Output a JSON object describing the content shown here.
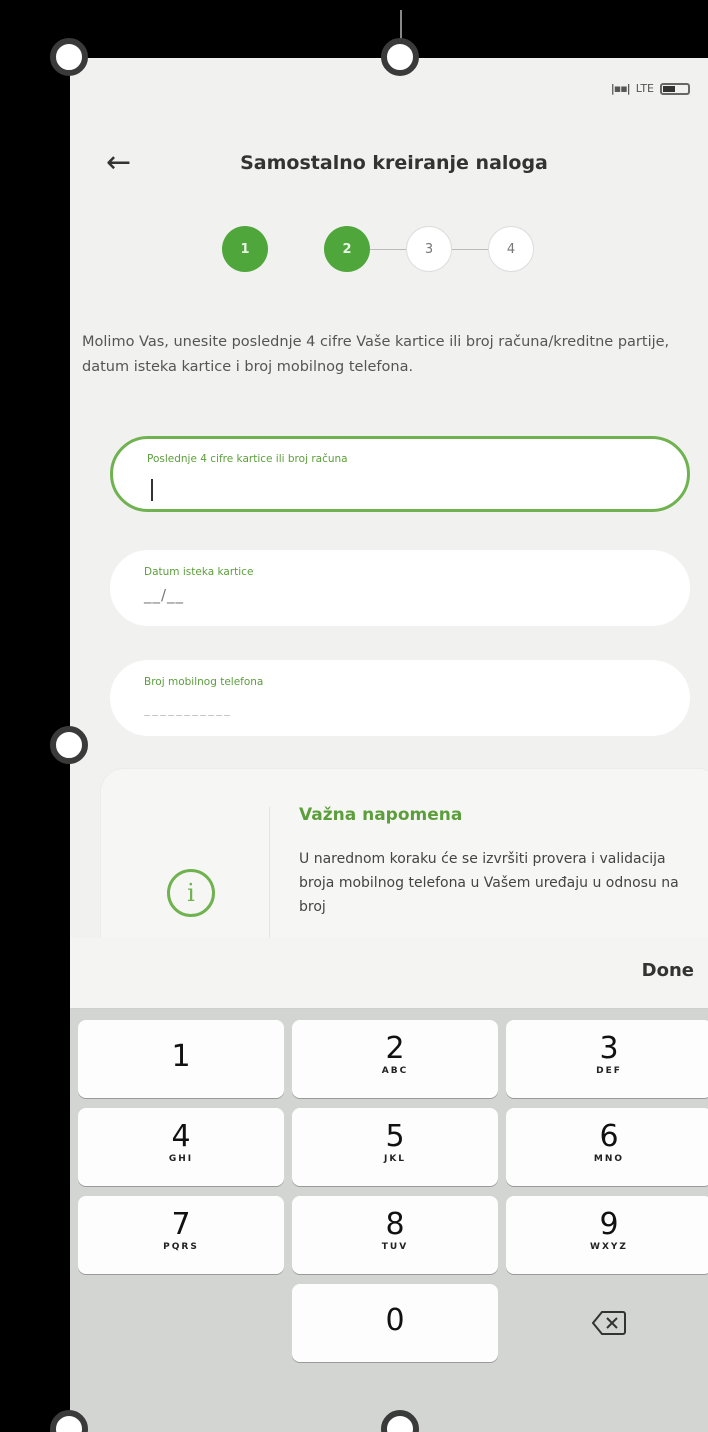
{
  "status_bar": {
    "signal": "|▪▪|",
    "network": "LTE"
  },
  "header": {
    "back_icon": "arrow-left-icon",
    "title": "Samostalno kreiranje naloga"
  },
  "stepper": {
    "steps": [
      {
        "label": "1",
        "state": "done"
      },
      {
        "label": "2",
        "state": "done"
      },
      {
        "label": "3",
        "state": "todo"
      },
      {
        "label": "4",
        "state": "todo"
      }
    ],
    "accent": "#4fa63a"
  },
  "intro_text": "Molimo Vas, unesite poslednje 4 cifre Vaše kartice ili broj računa/kreditne partije, datum isteka kartice i broj mobilnog telefona.",
  "fields": {
    "card_or_account": {
      "label": "Poslednje 4 cifre kartice ili broj računa",
      "value": ""
    },
    "expiry": {
      "label": "Datum isteka kartice",
      "placeholder": "__/__"
    },
    "phone": {
      "label": "Broj mobilnog telefona",
      "placeholder": "___________"
    }
  },
  "note": {
    "icon": "info-icon",
    "title": "Važna napomena",
    "text": "U narednom koraku će se izvršiti provera i validacija broja mobilnog telefona u Vašem uređaju u odnosu na broj"
  },
  "keyboard": {
    "done_label": "Done",
    "keys": [
      {
        "digit": "1",
        "letters": ""
      },
      {
        "digit": "2",
        "letters": "ABC"
      },
      {
        "digit": "3",
        "letters": "DEF"
      },
      {
        "digit": "4",
        "letters": "GHI"
      },
      {
        "digit": "5",
        "letters": "JKL"
      },
      {
        "digit": "6",
        "letters": "MNO"
      },
      {
        "digit": "7",
        "letters": "PQRS"
      },
      {
        "digit": "8",
        "letters": "TUV"
      },
      {
        "digit": "9",
        "letters": "WXYZ"
      },
      {
        "digit": "0",
        "letters": ""
      }
    ],
    "backspace_icon": "backspace-icon"
  }
}
